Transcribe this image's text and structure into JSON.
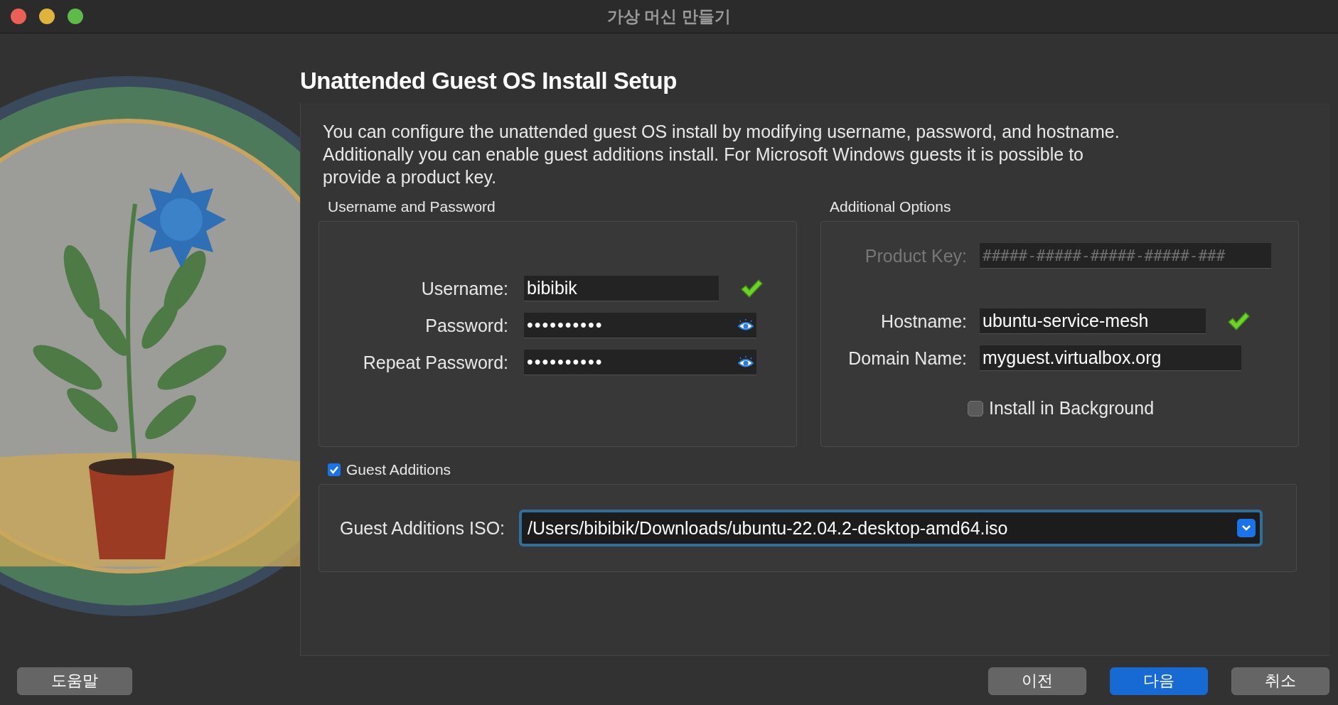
{
  "window": {
    "title": "가상 머신 만들기"
  },
  "page": {
    "title": "Unattended Guest OS Install Setup",
    "description": "You can configure the unattended guest OS install by modifying username, password, and hostname. Additionally you can enable guest additions install. For Microsoft Windows guests it is possible to provide a product key."
  },
  "credentials": {
    "title": "Username and Password",
    "fields": [
      {
        "kind": "text",
        "label": "Username:",
        "value": "bibibik",
        "valid": true
      },
      {
        "kind": "password",
        "label": "Password:",
        "value": "••••••••••"
      },
      {
        "kind": "password",
        "label": "Repeat Password:",
        "value": "••••••••••"
      }
    ]
  },
  "options": {
    "title": "Additional Options",
    "fields": [
      {
        "kind": "key",
        "label": "Product Key:",
        "placeholder": "#####-#####-#####-#####-###",
        "disabled": true
      },
      {
        "kind": "text",
        "label": "Hostname:",
        "value": "ubuntu-service-mesh",
        "valid": true
      },
      {
        "kind": "text",
        "label": "Domain Name:",
        "value": "myguest.virtualbox.org"
      }
    ],
    "install_in_background": {
      "label": "Install in Background",
      "checked": false
    }
  },
  "guest_additions": {
    "label": "Guest Additions",
    "checked": true,
    "iso_label": "Guest Additions ISO:",
    "iso_value": "/Users/bibibik/Downloads/ubuntu-22.04.2-desktop-amd64.iso",
    "focused": true
  },
  "help_button": {
    "label": "도움말"
  },
  "nav_buttons": [
    {
      "label": "이전",
      "primary": false
    },
    {
      "label": "다음",
      "primary": true
    },
    {
      "label": "취소",
      "primary": false
    }
  ]
}
